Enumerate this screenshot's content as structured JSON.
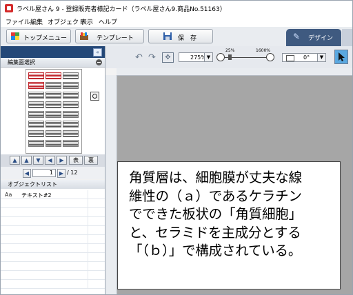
{
  "window": {
    "title": "ラベル屋さん 9 - 登録販売者様記カード（ラベル屋さん9.商品No.51163）"
  },
  "menu": [
    "ファイル",
    "編集",
    "オブジェクト",
    "表示",
    "ヘルプ"
  ],
  "toolbar": {
    "top_menu_label": "トップメニュー",
    "template_label": "テンプレート",
    "save_label": "保　存",
    "design_tab_label": "デザイン"
  },
  "left_panel": {
    "edit_area_header": "編集面選択",
    "nav_front": "表",
    "nav_back": "裏",
    "page_current": "1",
    "page_total": "/ 12",
    "object_list_header": "オブジェクトリスト",
    "objects": [
      "テキスト#2"
    ]
  },
  "canvas_toolbar": {
    "zoom_value": "275%",
    "slider_min_label": "25%",
    "slider_max_label": "1600%",
    "rotation_value": "0°"
  },
  "label": {
    "text": "角質層は、細胞膜が丈夫な線\n維性の（ａ）であるケラチン\nでできた板状の「角質細胞」\nと、セラミドを主成分とする\n「（ｂ）」で構成されている。"
  },
  "colors": {
    "panel_header": "#244878",
    "design_tab": "#3f5a80",
    "canvas_bg": "#a6a6a6"
  }
}
